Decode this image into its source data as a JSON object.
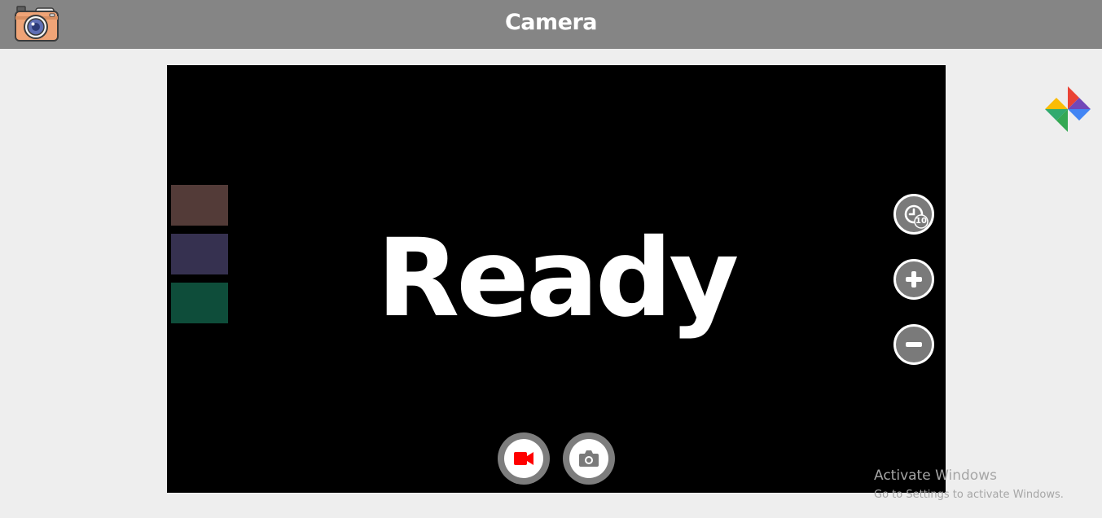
{
  "header": {
    "title": "Camera",
    "app_icon": "camera-app-icon",
    "background_color": "#858585"
  },
  "viewport": {
    "status_text": "Ready",
    "background_color": "#000000"
  },
  "filters": [
    {
      "name": "filter-brown",
      "color": "#533b38"
    },
    {
      "name": "filter-indigo",
      "color": "#363150"
    },
    {
      "name": "filter-green",
      "color": "#0e4d3a"
    }
  ],
  "controls": {
    "timer": {
      "icon": "timer-icon",
      "badge": "10"
    },
    "zoom_in": {
      "icon": "plus-icon"
    },
    "zoom_out": {
      "icon": "minus-icon"
    },
    "record": {
      "icon": "video-camera-icon",
      "color": "#ff0000"
    },
    "capture": {
      "icon": "camera-icon"
    }
  },
  "gallery": {
    "icon": "pinwheel-photos-icon"
  },
  "watermark": {
    "title": "Activate Windows",
    "subtitle": "Go to Settings to activate Windows."
  }
}
